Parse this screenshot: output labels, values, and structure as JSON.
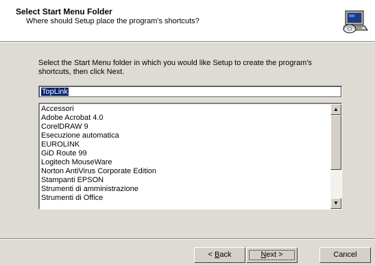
{
  "header": {
    "title": "Select Start Menu Folder",
    "subtitle": "Where should Setup place the program's shortcuts?",
    "icon": "setup-computer-icon"
  },
  "main": {
    "instruction": "Select the Start Menu folder in which you would like Setup to create the program's shortcuts, then click Next.",
    "folder_input": {
      "value": "TopLink"
    },
    "folder_list": {
      "items": [
        "Accessori",
        "Adobe Acrobat 4.0",
        "CorelDRAW 9",
        "Esecuzione automatica",
        "EUROLINK",
        "GiD Route 99",
        "Logitech MouseWare",
        "Norton AntiVirus Corporate Edition",
        "Stampanti EPSON",
        "Strumenti di amministrazione",
        "Strumenti di Office"
      ]
    }
  },
  "buttons": {
    "back": {
      "prefix": "< ",
      "accel": "B",
      "rest": "ack"
    },
    "next": {
      "accel": "N",
      "rest": "ext >"
    },
    "cancel": "Cancel"
  }
}
